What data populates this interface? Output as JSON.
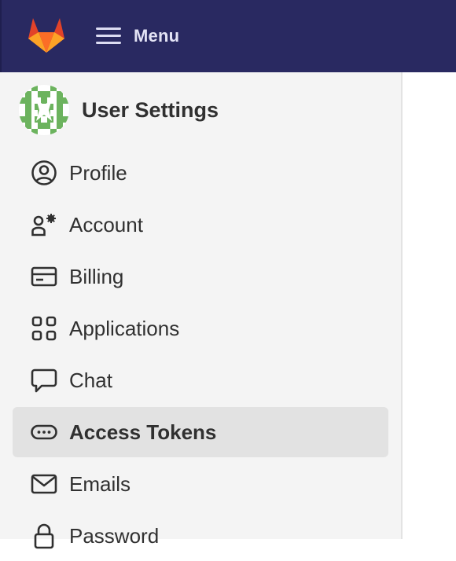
{
  "header": {
    "logo_icon": "gitlab-tanuki-logo-icon",
    "menu_label": "Menu",
    "menu_icon": "hamburger-icon",
    "background": "#292961"
  },
  "sidebar": {
    "title": "User Settings",
    "avatar_icon": "identicon-avatar",
    "items": [
      {
        "label": "Profile",
        "icon": "user-circle-icon",
        "active": false
      },
      {
        "label": "Account",
        "icon": "user-gear-icon",
        "active": false
      },
      {
        "label": "Billing",
        "icon": "credit-card-icon",
        "active": false
      },
      {
        "label": "Applications",
        "icon": "grid-icon",
        "active": false
      },
      {
        "label": "Chat",
        "icon": "speech-bubble-icon",
        "active": false
      },
      {
        "label": "Access Tokens",
        "icon": "token-icon",
        "active": true
      },
      {
        "label": "Emails",
        "icon": "envelope-icon",
        "active": false
      },
      {
        "label": "Password",
        "icon": "lock-icon",
        "active": false
      }
    ]
  }
}
